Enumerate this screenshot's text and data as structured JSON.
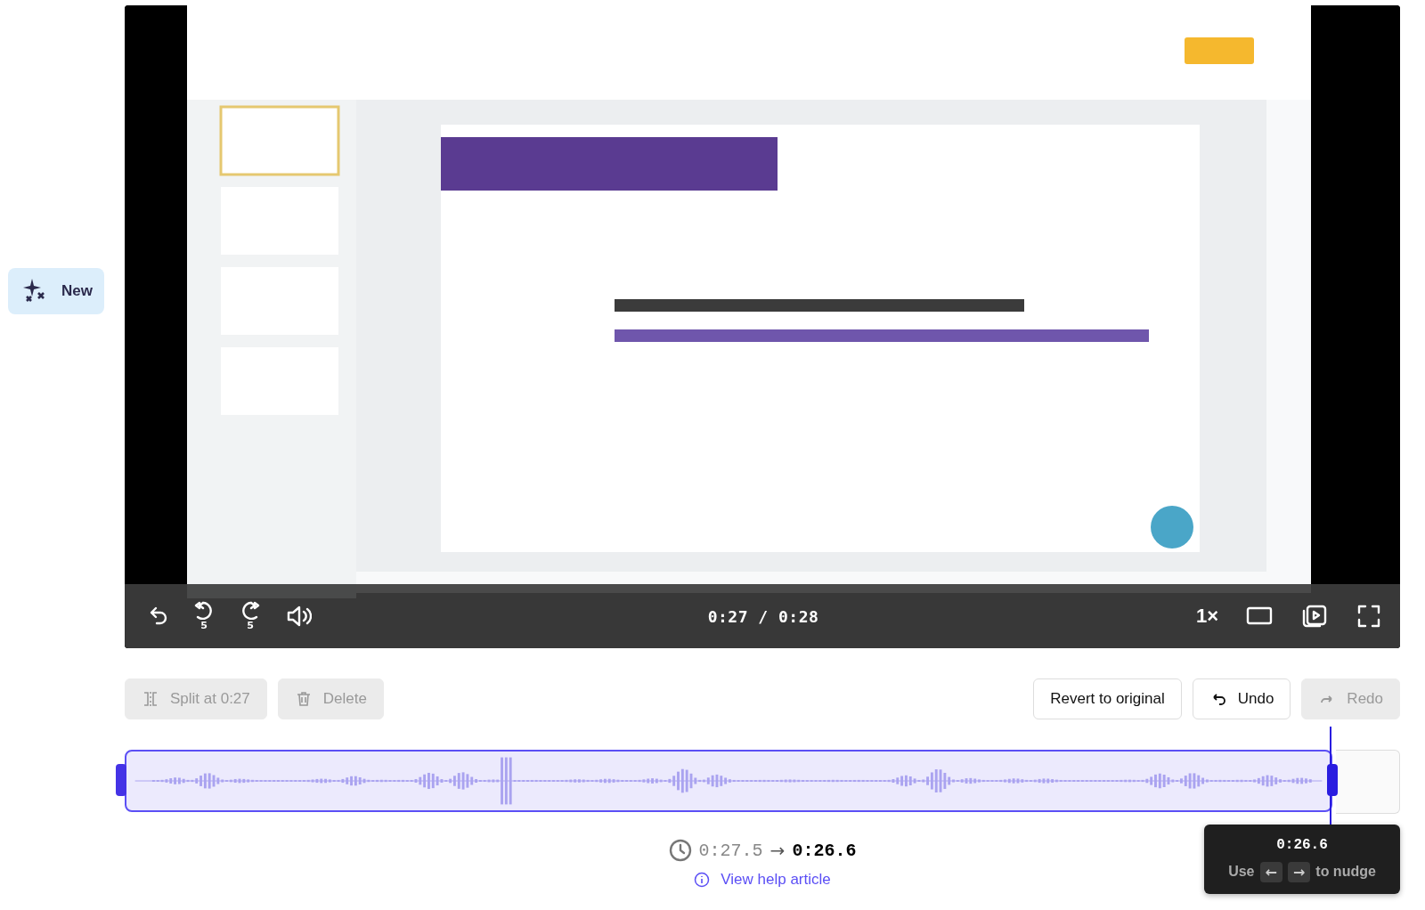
{
  "new_button": {
    "label": "New"
  },
  "video": {
    "kind": "picture",
    "controls": {
      "rewind_label": "5",
      "forward_label": "5",
      "time": "0:27 / 0:28",
      "speed": "1×"
    }
  },
  "toolbar": {
    "left": [
      {
        "kind": "split",
        "label": "Split at 0:27",
        "disabled": true
      },
      {
        "kind": "delete",
        "label": "Delete",
        "disabled": true
      }
    ],
    "right": [
      {
        "kind": "revert",
        "label": "Revert to original",
        "disabled": false
      },
      {
        "kind": "undo",
        "label": "Undo",
        "disabled": false
      },
      {
        "kind": "redo",
        "label": "Redo",
        "disabled": true
      }
    ]
  },
  "trim": {
    "from": "0:27.5",
    "arrow": "→",
    "to": "0:26.6"
  },
  "help_link": "View help article",
  "tooltip": {
    "time": "0:26.6",
    "prefix": "Use",
    "keys": [
      "←",
      "→"
    ],
    "suffix": "to nudge"
  }
}
